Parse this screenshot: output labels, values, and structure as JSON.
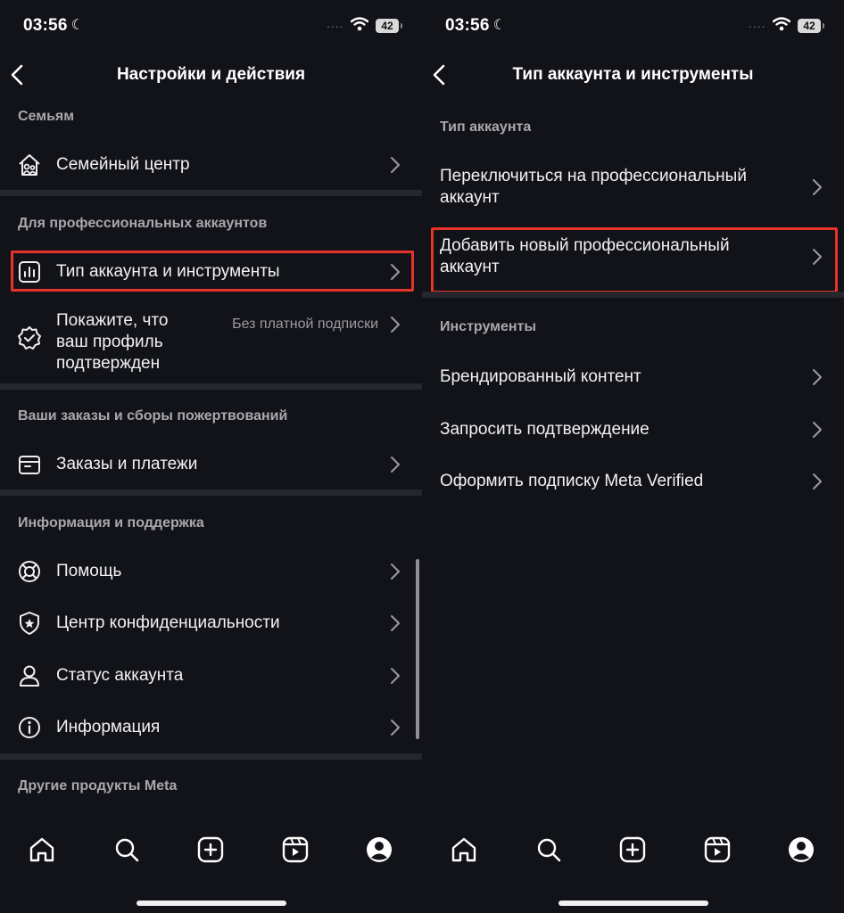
{
  "status": {
    "time": "03:56",
    "dots": "....",
    "battery": "42"
  },
  "left": {
    "title": "Настройки и действия",
    "sections": {
      "family": "Семьям",
      "pro": "Для профессиональных аккаунтов",
      "orders": "Ваши заказы и сборы пожертвований",
      "info": "Информация и поддержка",
      "meta": "Другие продукты Meta"
    },
    "items": {
      "family_center": "Семейный центр",
      "account_type": "Тип аккаунта и инструменты",
      "verified": "Покажите, что ваш профиль подтвержден",
      "verified_sub": "Без платной подписки",
      "orders": "Заказы и платежи",
      "help": "Помощь",
      "privacy": "Центр конфиденциальности",
      "status": "Статус аккаунта",
      "info": "Информация"
    }
  },
  "right": {
    "title": "Тип аккаунта и инструменты",
    "sections": {
      "type": "Тип аккаунта",
      "tools": "Инструменты"
    },
    "items": {
      "switch_pro": "Переключиться на профессиональный аккаунт",
      "add_pro": "Добавить новый профессиональный аккаунт",
      "branded": "Брендированный контент",
      "request_verify": "Запросить подтверждение",
      "meta_verified": "Оформить подписку Meta Verified"
    }
  },
  "colors": {
    "background": "#121318",
    "highlight": "#e8332a",
    "divider": "#26272c"
  },
  "tabs": [
    "home-icon",
    "search-icon",
    "create-icon",
    "reels-icon",
    "profile-icon"
  ]
}
